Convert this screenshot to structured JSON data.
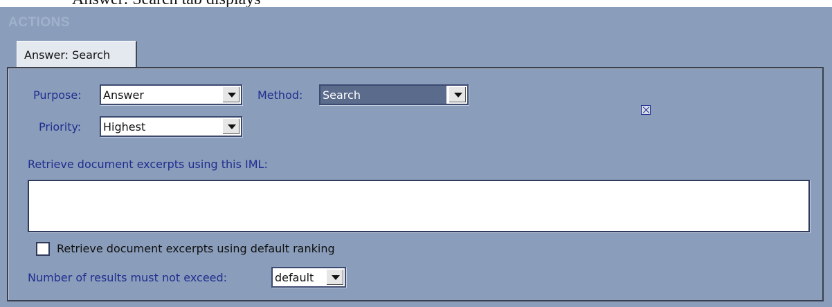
{
  "caption": "Answer: Search tab displays",
  "section_title": "ACTIONS",
  "tab": {
    "label": "Answer: Search"
  },
  "purpose": {
    "label": "Purpose:",
    "value": "Answer"
  },
  "priority": {
    "label": "Priority:",
    "value": "Highest"
  },
  "method": {
    "label": "Method:",
    "value": "Search"
  },
  "close_icon": "close-x-icon",
  "iml": {
    "label": "Retrieve document excerpts using this IML:",
    "value": ""
  },
  "default_ranking": {
    "label": "Retrieve document excerpts using default ranking",
    "checked": false
  },
  "max_results": {
    "label": "Number of results must not exceed:",
    "value": "default"
  },
  "colors": {
    "panel_bg": "#8a9dbb",
    "label_blue": "#1f2d8f",
    "selection": "#5a6b8c"
  }
}
